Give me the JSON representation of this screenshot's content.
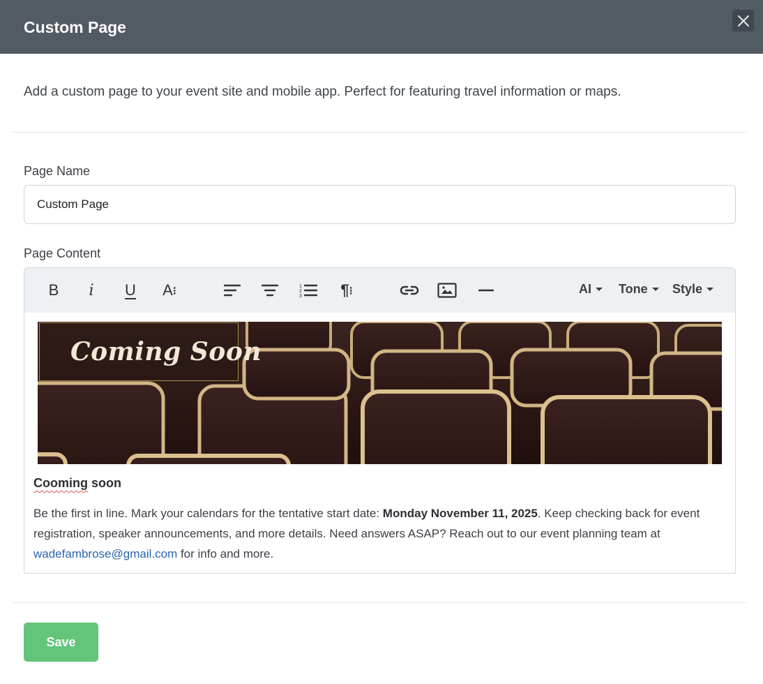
{
  "modal": {
    "title": "Custom Page",
    "intro": "Add a custom page to your event site and mobile app. Perfect for featuring travel information or maps."
  },
  "page_name": {
    "label": "Page Name",
    "value": "Custom Page"
  },
  "page_content": {
    "label": "Page Content",
    "toolbar": {
      "bold": "B",
      "italic": "i",
      "underline": "U",
      "font_size": "A",
      "ai_label": "AI",
      "tone_label": "Tone",
      "style_label": "Style",
      "icons": [
        "bold-icon",
        "italic-icon",
        "underline-icon",
        "font-size-icon",
        "align-left-icon",
        "align-center-icon",
        "ordered-list-icon",
        "paragraph-format-icon",
        "link-icon",
        "image-icon",
        "horizontal-rule-icon"
      ]
    },
    "banner": {
      "label": "Coming Soon"
    },
    "heading_word1": "Cooming",
    "heading_word2": " soon",
    "body": {
      "part1": "Be the first in line. Mark your calendars for the tentative start date: ",
      "date": "Monday November 11, 2025",
      "part2": ". Keep checking back for event registration, speaker announcements, and more details. Need answers ASAP? Reach out to our event planning team at ",
      "email": "wadefambrose@gmail.com",
      "part3": " for info and more."
    }
  },
  "footer": {
    "save_label": "Save"
  },
  "colors": {
    "header_bg": "#525a63",
    "save_button": "#63c57b",
    "link": "#2a64b1"
  }
}
